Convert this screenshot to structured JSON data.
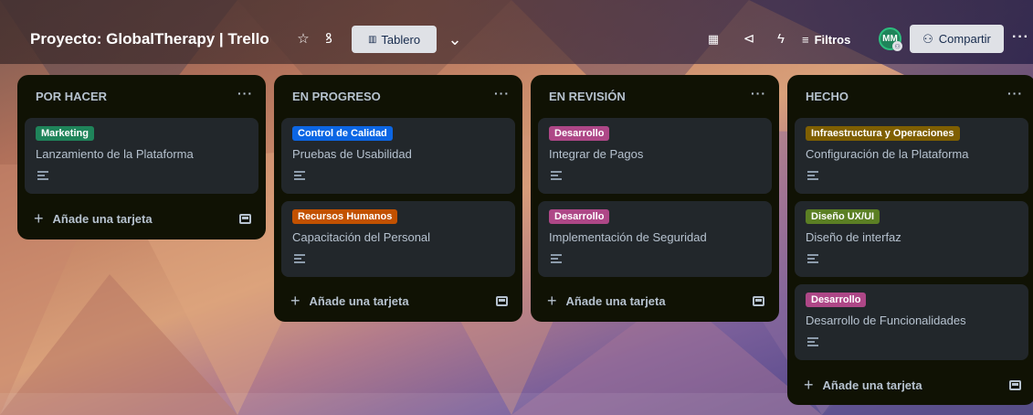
{
  "board": {
    "title": "Proyecto: GlobalTherapy | Trello",
    "view_label": "Tablero",
    "filters_label": "Filtros",
    "avatar_initials": "MM",
    "share_label": "Compartir"
  },
  "icons": {
    "star": "☆",
    "workspace": "ꝸ",
    "board_view": "▥",
    "chevron": "⌄",
    "calendar": "▦",
    "send": "⊲",
    "power": "ϟ",
    "filter": "≡",
    "share": "⚇",
    "more": "···",
    "plus": "+"
  },
  "add_card_label": "Añade una tarjeta",
  "colors": {
    "green": "#1f845a",
    "blue": "#0c66e4",
    "orange": "#c25100",
    "pink": "#ae4787",
    "yellow": "#7f5f01",
    "lime": "#5b7f24"
  },
  "lists": [
    {
      "name": "POR HACER",
      "cards": [
        {
          "label": "Marketing",
          "label_color": "#1f845a",
          "title": "Lanzamiento de la Plataforma"
        }
      ]
    },
    {
      "name": "EN PROGRESO",
      "cards": [
        {
          "label": "Control de Calidad",
          "label_color": "#0c66e4",
          "title": "Pruebas de Usabilidad"
        },
        {
          "label": "Recursos Humanos",
          "label_color": "#c25100",
          "title": "Capacitación del Personal"
        }
      ]
    },
    {
      "name": "EN REVISIÓN",
      "cards": [
        {
          "label": "Desarrollo",
          "label_color": "#ae4787",
          "title": "Integrar de Pagos"
        },
        {
          "label": "Desarrollo",
          "label_color": "#ae4787",
          "title": "Implementación de Seguridad"
        }
      ]
    },
    {
      "name": "HECHO",
      "cards": [
        {
          "label": "Infraestructura y Operaciones",
          "label_color": "#7f5f01",
          "title": "Configuración de la Plataforma"
        },
        {
          "label": "Diseño UX/UI",
          "label_color": "#5b7f24",
          "title": "Diseño de interfaz"
        },
        {
          "label": "Desarrollo",
          "label_color": "#ae4787",
          "title": "Desarrollo de Funcionalidades"
        }
      ]
    }
  ]
}
